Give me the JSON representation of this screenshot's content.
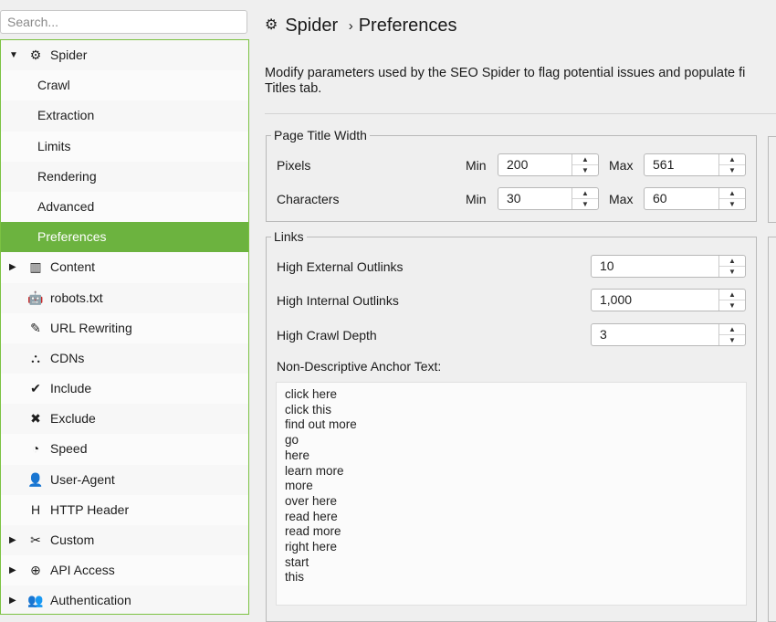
{
  "search": {
    "placeholder": "Search..."
  },
  "sidebar": {
    "items": [
      {
        "label": "Spider",
        "icon": "gear-icon",
        "glyph": "⚙",
        "arrow": "▼"
      },
      {
        "label": "Crawl"
      },
      {
        "label": "Extraction"
      },
      {
        "label": "Limits"
      },
      {
        "label": "Rendering"
      },
      {
        "label": "Advanced"
      },
      {
        "label": "Preferences",
        "selected": true
      },
      {
        "label": "Content",
        "icon": "columns-icon",
        "glyph": "▥",
        "arrow": "▶"
      },
      {
        "label": "robots.txt",
        "icon": "robot-icon",
        "glyph": "🤖"
      },
      {
        "label": "URL Rewriting",
        "icon": "edit-icon",
        "glyph": "✎"
      },
      {
        "label": "CDNs",
        "icon": "network-icon",
        "glyph": "⛬"
      },
      {
        "label": "Include",
        "icon": "check-circle-icon",
        "glyph": "✔"
      },
      {
        "label": "Exclude",
        "icon": "x-circle-icon",
        "glyph": "✖"
      },
      {
        "label": "Speed",
        "icon": "gauge-icon",
        "glyph": "◔"
      },
      {
        "label": "User-Agent",
        "icon": "user-secret-icon",
        "glyph": "👤"
      },
      {
        "label": "HTTP Header",
        "icon": "heading-icon",
        "glyph": "H"
      },
      {
        "label": "Custom",
        "icon": "tools-icon",
        "glyph": "✂",
        "arrow": "▶"
      },
      {
        "label": "API Access",
        "icon": "globe-icon",
        "glyph": "⊕",
        "arrow": "▶"
      },
      {
        "label": "Authentication",
        "icon": "users-lock-icon",
        "glyph": "👥",
        "arrow": "▶"
      }
    ]
  },
  "header": {
    "icon": "gear-icon",
    "breadcrumb_root": "Spider",
    "separator": "›",
    "breadcrumb_page": "Preferences"
  },
  "description": {
    "line1": "Modify parameters used by the SEO Spider to flag potential issues and populate fi",
    "line2": "Titles tab."
  },
  "page_title_width": {
    "legend": "Page Title Width",
    "pixels_label": "Pixels",
    "characters_label": "Characters",
    "min_label": "Min",
    "max_label": "Max",
    "pixels_min": "200",
    "pixels_max": "561",
    "characters_min": "30",
    "characters_max": "60"
  },
  "links": {
    "legend": "Links",
    "high_external_label": "High External Outlinks",
    "high_external_value": "10",
    "high_internal_label": "High Internal Outlinks",
    "high_internal_value": "1,000",
    "high_crawl_depth_label": "High Crawl Depth",
    "high_crawl_depth_value": "3",
    "anchor_text_label": "Non-Descriptive Anchor Text:",
    "anchor_text_lines": [
      "click here",
      "click this",
      "find out more",
      "go",
      "here",
      "learn more",
      "more",
      "over here",
      "read here",
      "read more",
      "right here",
      "start",
      "this"
    ]
  },
  "spinner": {
    "up": "▲",
    "down": "▼"
  }
}
